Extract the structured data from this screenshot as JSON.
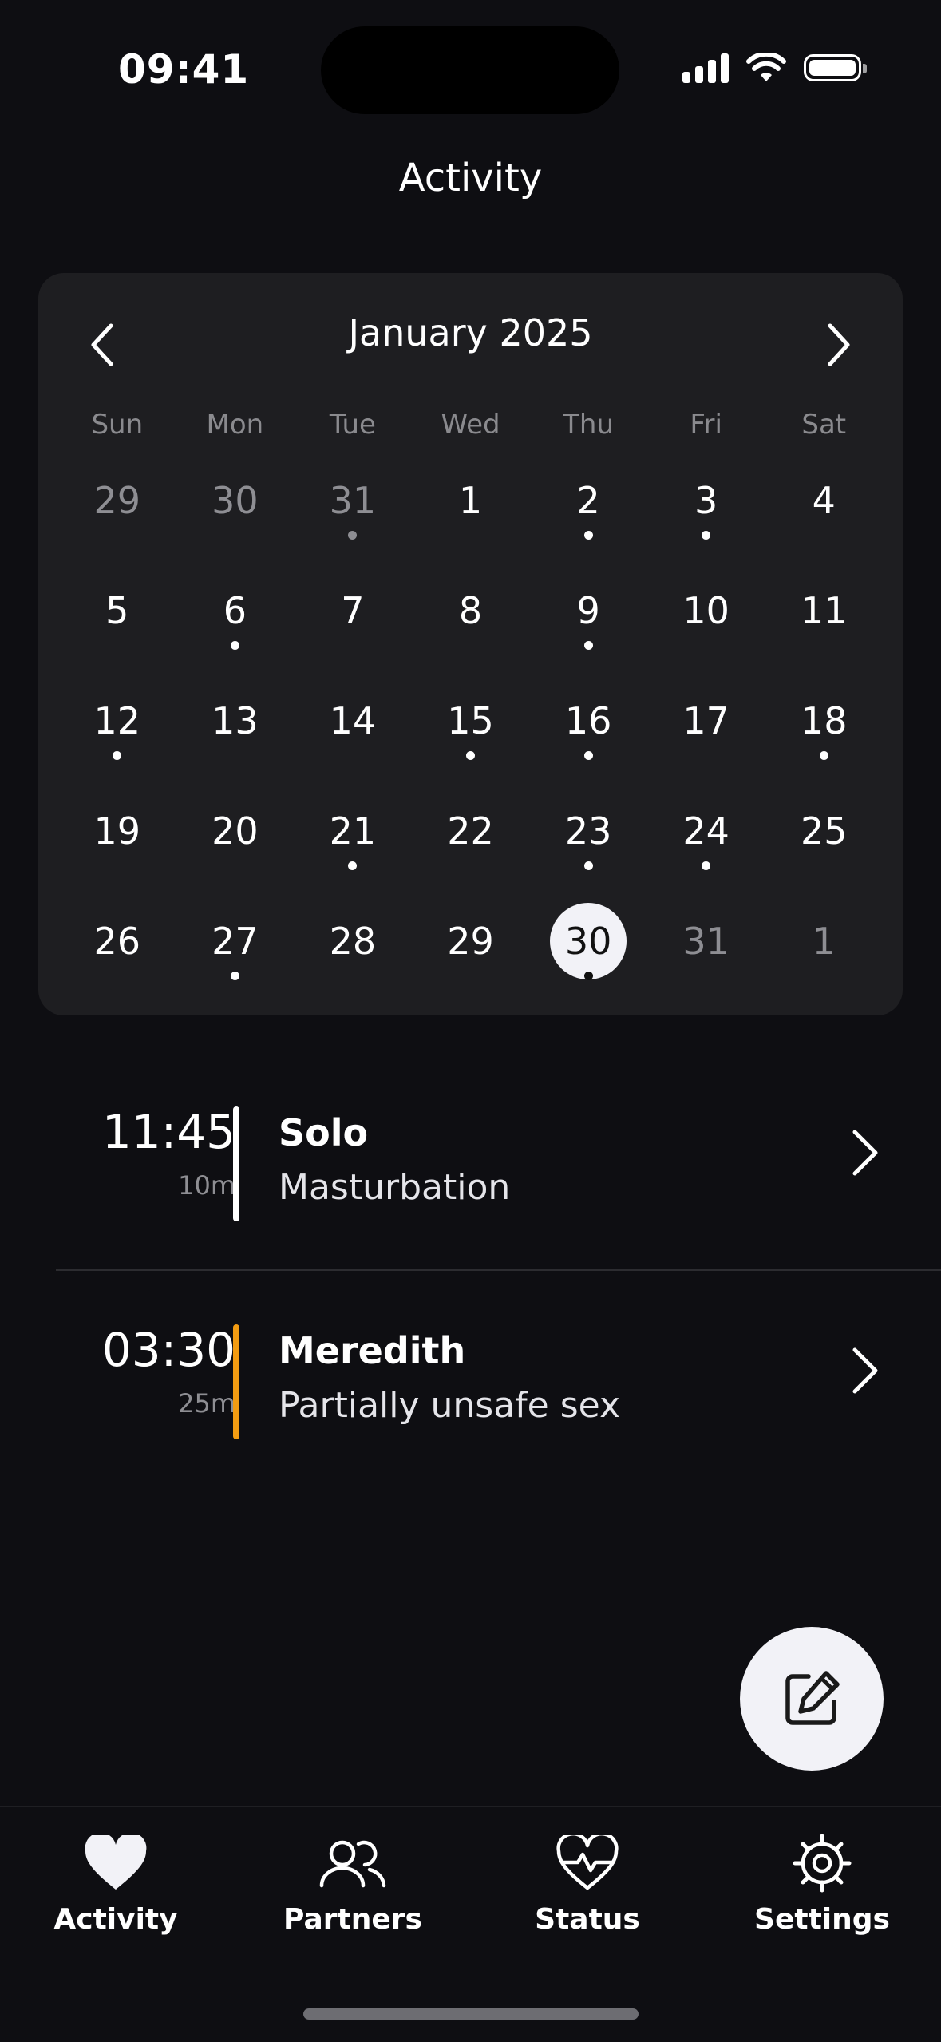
{
  "status_bar": {
    "time": "09:41"
  },
  "header": {
    "title": "Activity"
  },
  "calendar": {
    "month_label": "January 2025",
    "weekdays": [
      "Sun",
      "Mon",
      "Tue",
      "Wed",
      "Thu",
      "Fri",
      "Sat"
    ],
    "weeks": [
      [
        {
          "d": "29",
          "muted": true,
          "dot": false
        },
        {
          "d": "30",
          "muted": true,
          "dot": false
        },
        {
          "d": "31",
          "muted": true,
          "dot": true
        },
        {
          "d": "1",
          "dot": false
        },
        {
          "d": "2",
          "dot": true
        },
        {
          "d": "3",
          "dot": true
        },
        {
          "d": "4",
          "dot": false
        }
      ],
      [
        {
          "d": "5",
          "dot": false
        },
        {
          "d": "6",
          "dot": true
        },
        {
          "d": "7",
          "dot": false
        },
        {
          "d": "8",
          "dot": false
        },
        {
          "d": "9",
          "dot": true
        },
        {
          "d": "10",
          "dot": false
        },
        {
          "d": "11",
          "dot": false
        }
      ],
      [
        {
          "d": "12",
          "dot": true
        },
        {
          "d": "13",
          "dot": false
        },
        {
          "d": "14",
          "dot": false
        },
        {
          "d": "15",
          "dot": true
        },
        {
          "d": "16",
          "dot": true
        },
        {
          "d": "17",
          "dot": false
        },
        {
          "d": "18",
          "dot": true
        }
      ],
      [
        {
          "d": "19",
          "dot": false
        },
        {
          "d": "20",
          "dot": false
        },
        {
          "d": "21",
          "dot": true
        },
        {
          "d": "22",
          "dot": false
        },
        {
          "d": "23",
          "dot": true
        },
        {
          "d": "24",
          "dot": true
        },
        {
          "d": "25",
          "dot": false
        }
      ],
      [
        {
          "d": "26",
          "dot": false
        },
        {
          "d": "27",
          "dot": true
        },
        {
          "d": "28",
          "dot": false
        },
        {
          "d": "29",
          "dot": false
        },
        {
          "d": "30",
          "dot": true,
          "selected": true
        },
        {
          "d": "31",
          "muted": true,
          "dot": false
        },
        {
          "d": "1",
          "muted": true,
          "dot": false
        }
      ]
    ]
  },
  "entries": [
    {
      "time": "11:45",
      "duration": "10m",
      "name": "Solo",
      "description": "Masturbation",
      "bar_color": "#ffffff"
    },
    {
      "time": "03:30",
      "duration": "25m",
      "name": "Meredith",
      "description": "Partially unsafe sex",
      "bar_color": "#f39c12"
    }
  ],
  "fab": {
    "icon": "edit-icon"
  },
  "tabbar": {
    "tabs": [
      {
        "label": "Activity",
        "icon": "heart-icon",
        "active": true
      },
      {
        "label": "Partners",
        "icon": "people-icon"
      },
      {
        "label": "Status",
        "icon": "heart-pulse-icon"
      },
      {
        "label": "Settings",
        "icon": "gear-icon"
      }
    ]
  },
  "colors": {
    "background": "#0e0e12",
    "card": "#1e1e21",
    "accent_orange": "#f39c12",
    "muted": "#8e8e93"
  }
}
